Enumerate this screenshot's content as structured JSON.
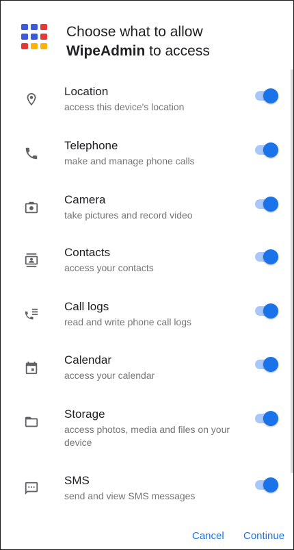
{
  "dialog": {
    "title_prefix": "Choose what to allow",
    "app_name": "WipeAdmin",
    "title_suffix": "to access"
  },
  "icon_colors": [
    "#3b5bdb",
    "#e53935",
    "#ffb300",
    "#1e88e5"
  ],
  "accent_color": "#1a73e8",
  "permissions": [
    {
      "icon": "location-pin-icon",
      "name": "Location",
      "description": "access this device's location",
      "enabled": true
    },
    {
      "icon": "phone-icon",
      "name": "Telephone",
      "description": "make and manage phone calls",
      "enabled": true
    },
    {
      "icon": "camera-icon",
      "name": "Camera",
      "description": "take pictures and record video",
      "enabled": true
    },
    {
      "icon": "contacts-icon",
      "name": "Contacts",
      "description": "access your contacts",
      "enabled": true
    },
    {
      "icon": "call-log-icon",
      "name": "Call logs",
      "description": "read and write phone call logs",
      "enabled": true
    },
    {
      "icon": "calendar-icon",
      "name": "Calendar",
      "description": "access your calendar",
      "enabled": true
    },
    {
      "icon": "folder-icon",
      "name": "Storage",
      "description": "access photos, media and files on your device",
      "enabled": true
    },
    {
      "icon": "sms-icon",
      "name": "SMS",
      "description": "send and view SMS messages",
      "enabled": true
    }
  ],
  "actions": {
    "cancel": "Cancel",
    "continue": "Continue"
  }
}
